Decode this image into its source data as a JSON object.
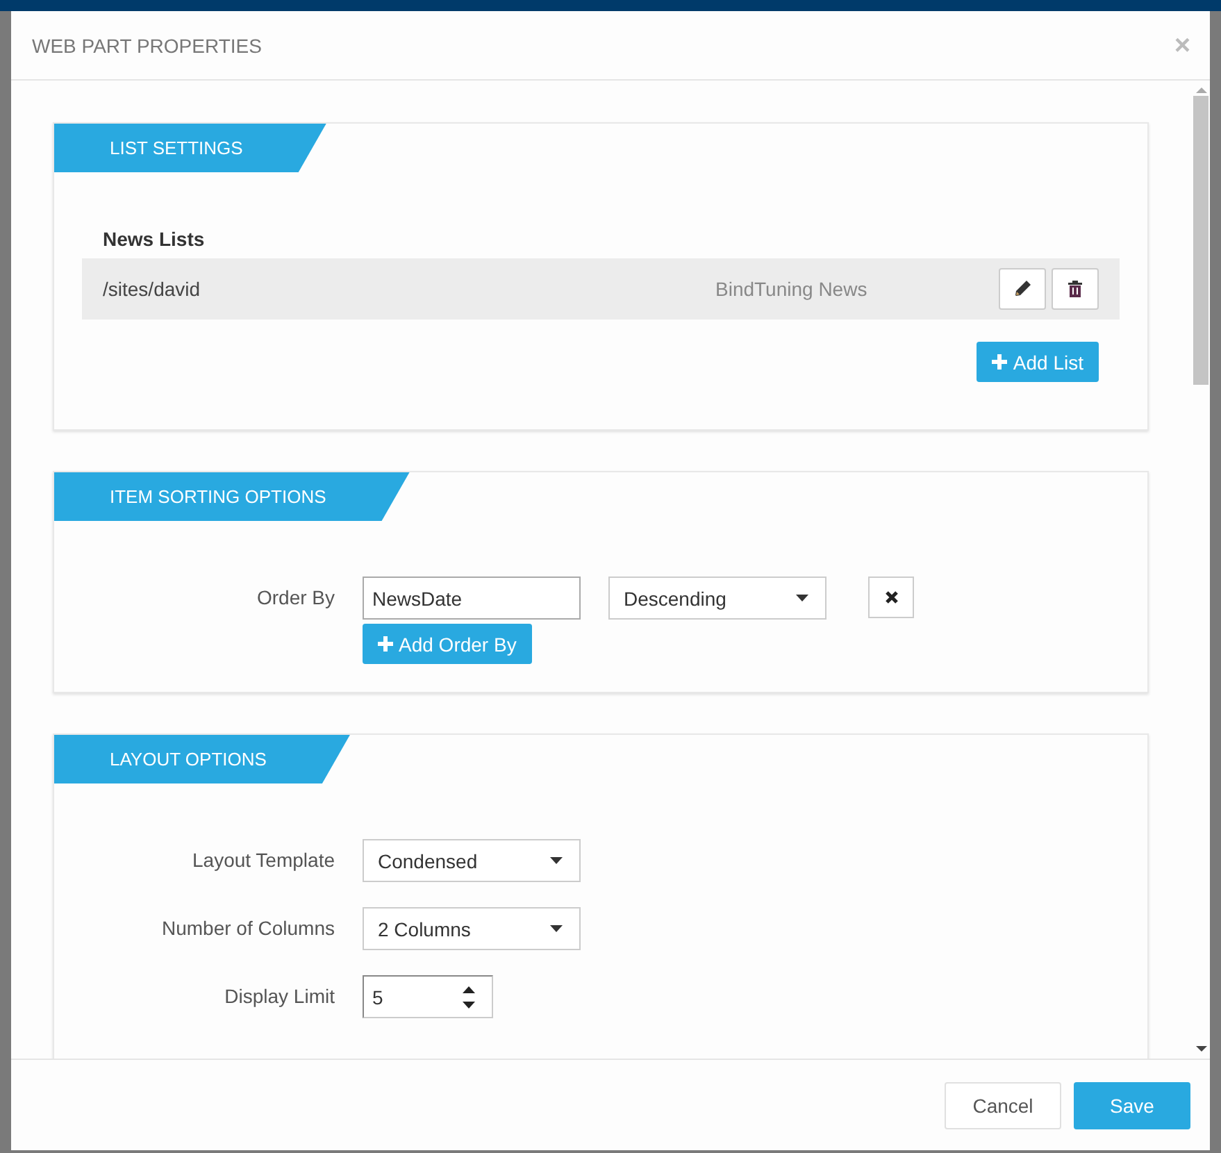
{
  "dialog": {
    "title": "WEB PART PROPERTIES",
    "close": "×"
  },
  "sections": [
    {
      "kind": "lists",
      "title": "LIST SETTINGS",
      "heading": "News Lists",
      "lists": [
        {
          "path": "/sites/david",
          "name": "BindTuning News"
        }
      ],
      "add_button": "Add List"
    },
    {
      "kind": "sorting",
      "title": "ITEM SORTING OPTIONS",
      "label": "Order By",
      "field_value": "NewsDate",
      "direction": "Descending",
      "add_button": "Add Order By"
    },
    {
      "kind": "form",
      "title": "LAYOUT OPTIONS",
      "fields": [
        {
          "kind": "select",
          "label": "Layout Template",
          "value": "Condensed"
        },
        {
          "kind": "select",
          "label": "Number of Columns",
          "value": "2 Columns"
        },
        {
          "kind": "number",
          "label": "Display Limit",
          "value": "5"
        }
      ]
    }
  ],
  "footer": {
    "buttons": [
      {
        "label": "Cancel",
        "kind": "secondary"
      },
      {
        "label": "Save",
        "kind": "primary"
      }
    ]
  }
}
